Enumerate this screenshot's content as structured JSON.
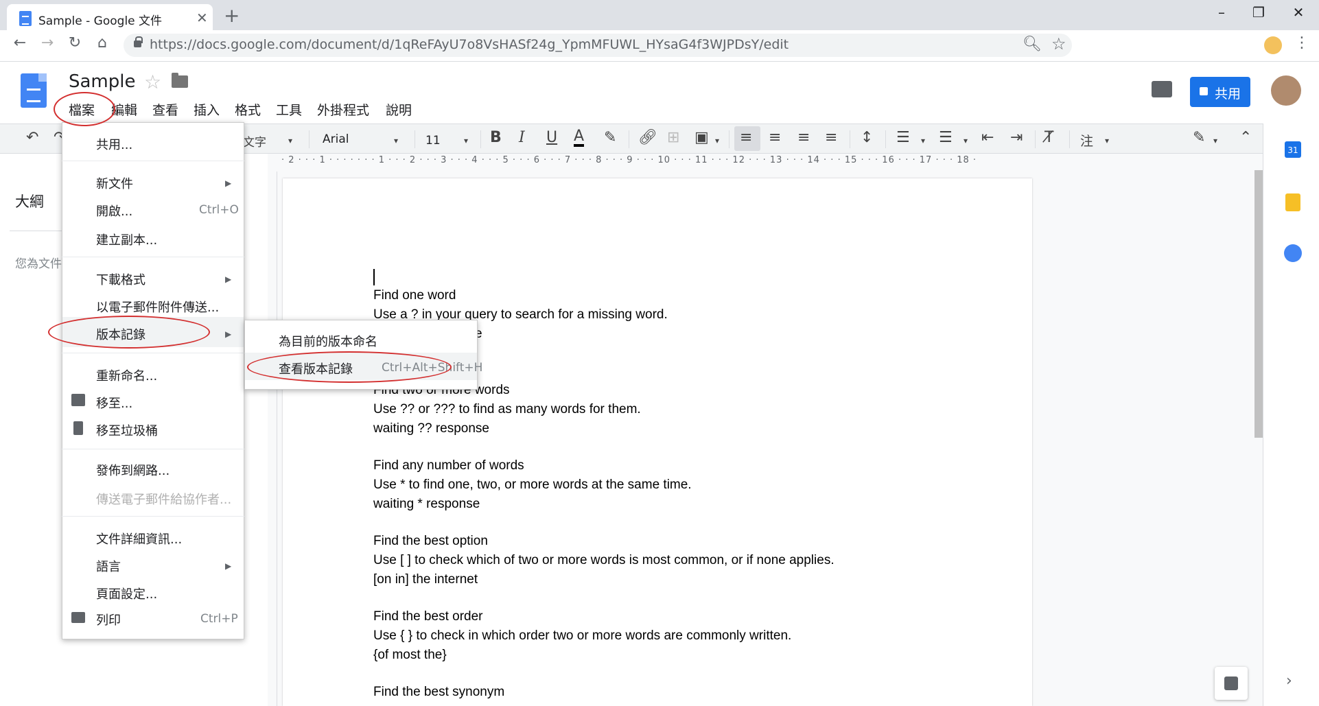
{
  "browser": {
    "tab_title": "Sample - Google 文件",
    "url": "https://docs.google.com/document/d/1qReFAyU7o8VsHASf24g_YpmMFUWL_HYsaG4f3WJPDsY/edit"
  },
  "docs": {
    "title": "Sample",
    "menu": [
      "檔案",
      "編輯",
      "查看",
      "插入",
      "格式",
      "工具",
      "外掛程式",
      "說明"
    ],
    "share_label": "共用"
  },
  "toolbar": {
    "style": "文字",
    "font": "Arial",
    "size": "11",
    "mode_label": "注"
  },
  "ruler": {
    "horizontal": "· 2 · · · 1 · · · · · · · 1 · · · 2 · · · 3 · · · 4 · · · 5 · · · 6 · · · 7 · · · 8 · · · 9 · · · 10 · · · 11 · · · 12 · · · 13 · · · 14 · · · 15 · · · 16 · · · 17 · · · 18 ·"
  },
  "outline": {
    "title": "大綱",
    "hint": "您為文件"
  },
  "file_menu": {
    "share": "共用...",
    "new": "新文件",
    "open": "開啟...",
    "open_shortcut": "Ctrl+O",
    "copy": "建立副本...",
    "download": "下載格式",
    "email_attach": "以電子郵件附件傳送...",
    "version_history": "版本記錄",
    "rename": "重新命名...",
    "move": "移至...",
    "trash": "移至垃圾桶",
    "publish": "發佈到網路...",
    "email_collab": "傳送電子郵件給協作者...",
    "details": "文件詳細資訊...",
    "language": "語言",
    "page_setup": "頁面設定...",
    "print": "列印",
    "print_shortcut": "Ctrl+P"
  },
  "submenu": {
    "name_version": "為目前的版本命名",
    "see_history": "查看版本記錄",
    "see_history_shortcut": "Ctrl+Alt+Shift+H"
  },
  "document": {
    "lines": [
      "Find one word",
      "Use a ? in your query to search for a missing word.",
      "e",
      "Find two or more words",
      "Use ?? or ??? to find as many words for them.",
      "waiting ?? response",
      "Find any number of words",
      "Use * to find one, two, or more words at the same time.",
      "waiting * response",
      "Find the best option",
      "Use [ ] to check which of two or more words is most common, or if none applies.",
      "[on in] the internet",
      "Find the best order",
      "Use { } to check in which order two or more words are commonly written.",
      "{of most the}",
      "Find the best synonym"
    ]
  }
}
